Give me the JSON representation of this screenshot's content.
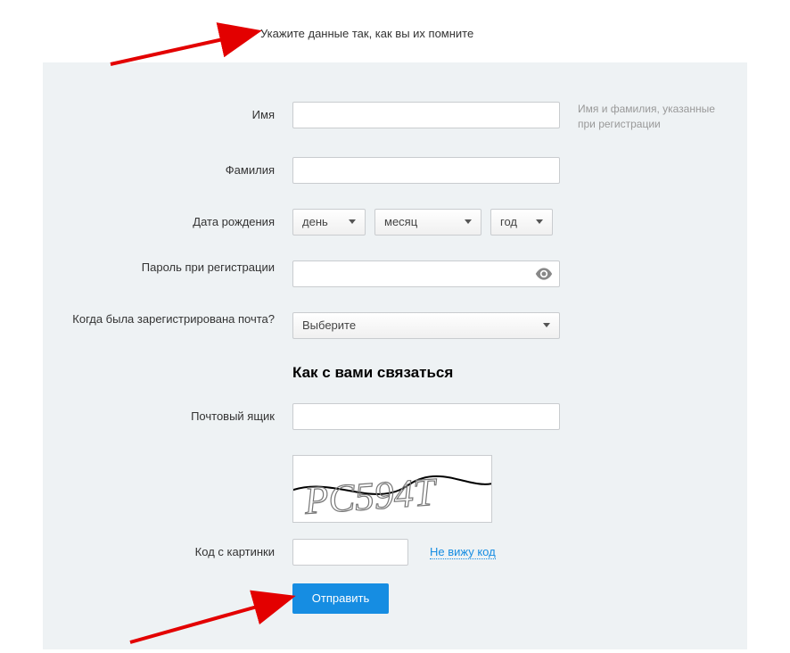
{
  "heading": "Укажите данные так, как вы их помните",
  "form": {
    "first_name_label": "Имя",
    "first_name_value": "",
    "first_name_hint": "Имя и фамилия, указанные при регистрации",
    "last_name_label": "Фамилия",
    "last_name_value": "",
    "dob_label": "Дата рождения",
    "dob_day_text": "день",
    "dob_month_text": "месяц",
    "dob_year_text": "год",
    "password_label": "Пароль при регистрации",
    "password_value": "",
    "registered_when_label": "Когда была зарегистрирована почта?",
    "registered_when_text": "Выберите"
  },
  "contact": {
    "heading": "Как с вами связаться",
    "mailbox_label": "Почтовый ящик",
    "mailbox_value": ""
  },
  "captcha": {
    "label": "Код с картинки",
    "value": "",
    "cant_see_link": "Не вижу код"
  },
  "submit_label": "Отправить"
}
